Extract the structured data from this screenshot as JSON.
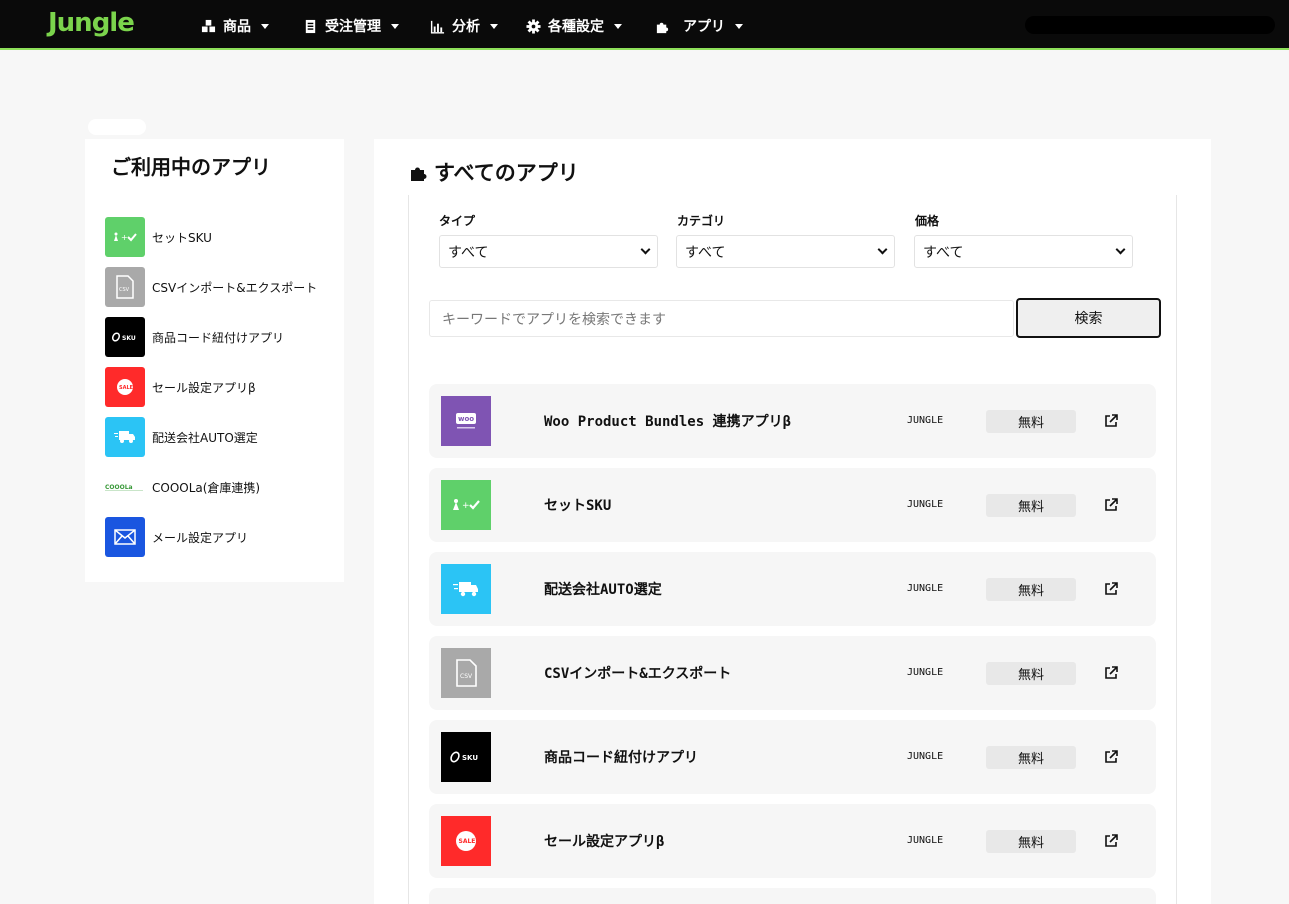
{
  "brand": {
    "logo_text": "Jungle",
    "accent": "#7bd44c",
    "nav_bg": "#0a0a0a"
  },
  "nav": [
    {
      "label": "商品",
      "icon": "boxes-icon"
    },
    {
      "label": "受注管理",
      "icon": "clipboard-icon"
    },
    {
      "label": "分析",
      "icon": "bar-chart-icon"
    },
    {
      "label": "各種設定",
      "icon": "gear-icon"
    },
    {
      "label": "アプリ",
      "icon": "puzzle-icon"
    }
  ],
  "sidebar": {
    "title": "ご利用中のアプリ",
    "items": [
      {
        "label": "セットSKU",
        "icon": "set-sku-icon",
        "color": "#5fd06a"
      },
      {
        "label": "CSVインポート&エクスポート",
        "icon": "csv-file-icon",
        "color": "#a9a9a9"
      },
      {
        "label": "商品コード紐付けアプリ",
        "icon": "link-sku-icon",
        "color": "#000000"
      },
      {
        "label": "セール設定アプリβ",
        "icon": "sale-tag-icon",
        "color": "#ff2a2a"
      },
      {
        "label": "配送会社AUTO選定",
        "icon": "delivery-truck-icon",
        "color": "#2bc4f5"
      },
      {
        "label": "COOOLa(倉庫連携)",
        "icon": "cooola-logo-icon",
        "color": "#ffffff"
      },
      {
        "label": "メール設定アプリ",
        "icon": "envelope-icon",
        "color": "#1a56e0"
      }
    ]
  },
  "main": {
    "title": "すべてのアプリ",
    "filters": [
      {
        "label": "タイプ",
        "value": "すべて"
      },
      {
        "label": "カテゴリ",
        "value": "すべて"
      },
      {
        "label": "価格",
        "value": "すべて"
      }
    ],
    "search": {
      "placeholder": "キーワードでアプリを検索できます",
      "button": "検索"
    },
    "apps": [
      {
        "name": "Woo Product Bundles 連携アプリβ",
        "developer": "JUNGLE",
        "price": "無料",
        "icon": "woo-bundles-icon",
        "color": "#7f54b3"
      },
      {
        "name": "セットSKU",
        "developer": "JUNGLE",
        "price": "無料",
        "icon": "set-sku-icon",
        "color": "#5fd06a"
      },
      {
        "name": "配送会社AUTO選定",
        "developer": "JUNGLE",
        "price": "無料",
        "icon": "delivery-truck-icon",
        "color": "#2bc4f5"
      },
      {
        "name": "CSVインポート&エクスポート",
        "developer": "JUNGLE",
        "price": "無料",
        "icon": "csv-file-icon",
        "color": "#a9a9a9"
      },
      {
        "name": "商品コード紐付けアプリ",
        "developer": "JUNGLE",
        "price": "無料",
        "icon": "link-sku-icon",
        "color": "#000000"
      },
      {
        "name": "セール設定アプリβ",
        "developer": "JUNGLE",
        "price": "無料",
        "icon": "sale-tag-icon",
        "color": "#ff2a2a"
      }
    ]
  }
}
